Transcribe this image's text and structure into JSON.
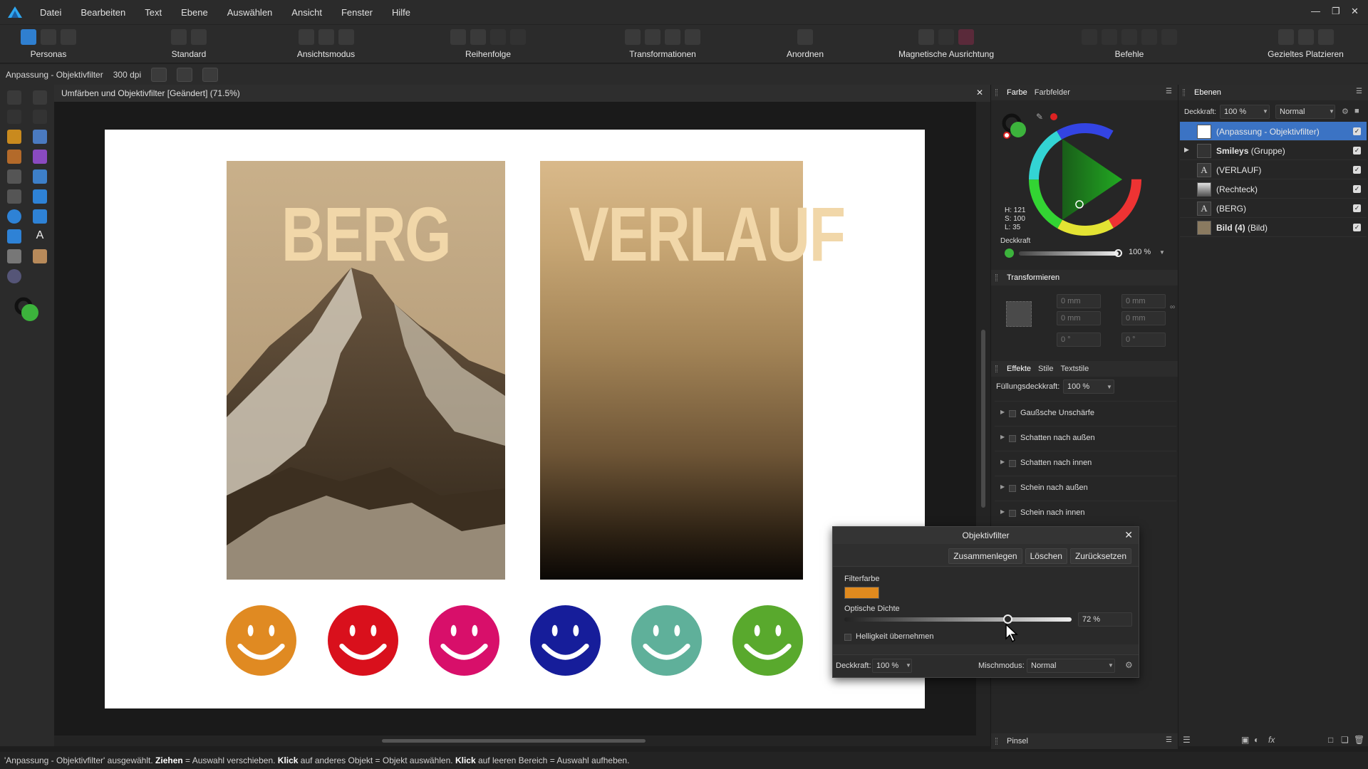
{
  "app": {
    "menu": [
      "Datei",
      "Bearbeiten",
      "Text",
      "Ebene",
      "Auswählen",
      "Ansicht",
      "Fenster",
      "Hilfe"
    ]
  },
  "toolbar": {
    "groups": [
      {
        "label": "Personas"
      },
      {
        "label": "Standard"
      },
      {
        "label": "Ansichtsmodus"
      },
      {
        "label": "Reihenfolge"
      },
      {
        "label": "Transformationen"
      },
      {
        "label": "Anordnen"
      },
      {
        "label": "Magnetische Ausrichtung"
      },
      {
        "label": "Befehle"
      },
      {
        "label": "Gezieltes Platzieren"
      }
    ]
  },
  "context": {
    "title": "Anpassung - Objektivfilter",
    "dpi": "300 dpi"
  },
  "document": {
    "tab_title": "Umfärben und Objektivfilter [Geändert] (71.5%)"
  },
  "artboard": {
    "poster1_title": "BERG",
    "poster2_title": "VERLAUF",
    "smiley_colors": [
      "#e08a22",
      "#d9101c",
      "#d80f6a",
      "#161d9a",
      "#5fb09a",
      "#59a92d"
    ]
  },
  "color_panel": {
    "tabs": [
      "Farbe",
      "Farbfelder"
    ],
    "hsl": {
      "h": "H: 121",
      "s": "S: 100",
      "l": "L: 35"
    },
    "opacity_label": "Deckkraft",
    "opacity_value": "100 %"
  },
  "transform_panel": {
    "title": "Transformieren",
    "fields": [
      "0 mm",
      "0 mm",
      "0 mm",
      "0 mm",
      "0 °",
      "0 °"
    ]
  },
  "effects_panel": {
    "tabs": [
      "Effekte",
      "Stile",
      "Textstile"
    ],
    "fill_opacity_label": "Füllungsdeckkraft:",
    "fill_opacity_value": "100 %",
    "effects": [
      "Gaußsche Unschärfe",
      "Schatten nach außen",
      "Schatten nach innen",
      "Schein nach außen",
      "Schein nach innen"
    ]
  },
  "brush_panel": {
    "title": "Pinsel"
  },
  "layers_panel": {
    "title": "Ebenen",
    "opacity_label": "Deckkraft:",
    "opacity_value": "100 %",
    "blend": "Normal",
    "layers": [
      {
        "name": "(Anpassung - Objektivfilter)",
        "selected": true
      },
      {
        "name": "Smileys",
        "suffix": " (Gruppe)",
        "bold": true
      },
      {
        "name": "(VERLAUF)"
      },
      {
        "name": "(Rechteck)"
      },
      {
        "name": "(BERG)"
      },
      {
        "name": "Bild (4)",
        "suffix": " (Bild)",
        "bold": true
      }
    ]
  },
  "dialog": {
    "title": "Objektivfilter",
    "buttons": [
      "Zusammenlegen",
      "Löschen",
      "Zurücksetzen"
    ],
    "filter_color_label": "Filterfarbe",
    "filter_color": "#e08a1e",
    "density_label": "Optische Dichte",
    "density_value": "72 %",
    "density_fraction": 0.72,
    "brightness_label": "Helligkeit übernehmen",
    "opacity_label": "Deckkraft:",
    "opacity_value": "100 %",
    "blend_label": "Mischmodus:",
    "blend_value": "Normal"
  },
  "status": {
    "part1": "'Anpassung - Objektivfilter' ausgewählt. ",
    "b1": "Ziehen",
    "part2": " = Auswahl verschieben. ",
    "b2": "Klick",
    "part3": " auf anderes Objekt = Objekt auswählen. ",
    "b3": "Klick",
    "part4": " auf leeren Bereich = Auswahl aufheben."
  }
}
